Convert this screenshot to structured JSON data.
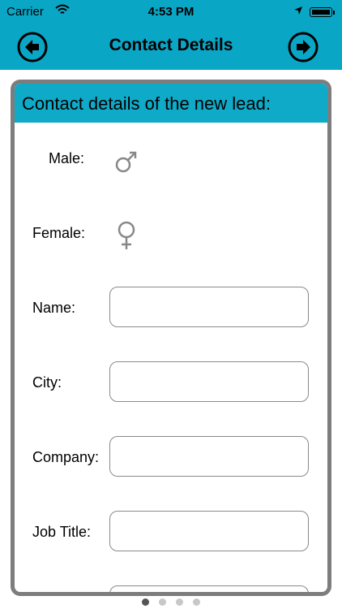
{
  "status": {
    "carrier": "Carrier",
    "time": "4:53 PM"
  },
  "nav": {
    "title": "Contact Details",
    "back_icon": "back-arrow-circle-icon",
    "forward_icon": "forward-arrow-circle-icon"
  },
  "card": {
    "header": "Contact details of the new lead:",
    "gender": {
      "male_label": "Male:",
      "female_label": "Female:",
      "male_icon": "male-symbol-icon",
      "female_icon": "female-symbol-icon"
    },
    "fields": [
      {
        "label": "Name:",
        "value": ""
      },
      {
        "label": "City:",
        "value": ""
      },
      {
        "label": "Company:",
        "value": ""
      },
      {
        "label": "Job Title:",
        "value": ""
      }
    ]
  },
  "page_indicator": {
    "total": 4,
    "active": 1
  },
  "colors": {
    "accent": "#0aa6c6",
    "card_border": "#7d7d7d"
  }
}
